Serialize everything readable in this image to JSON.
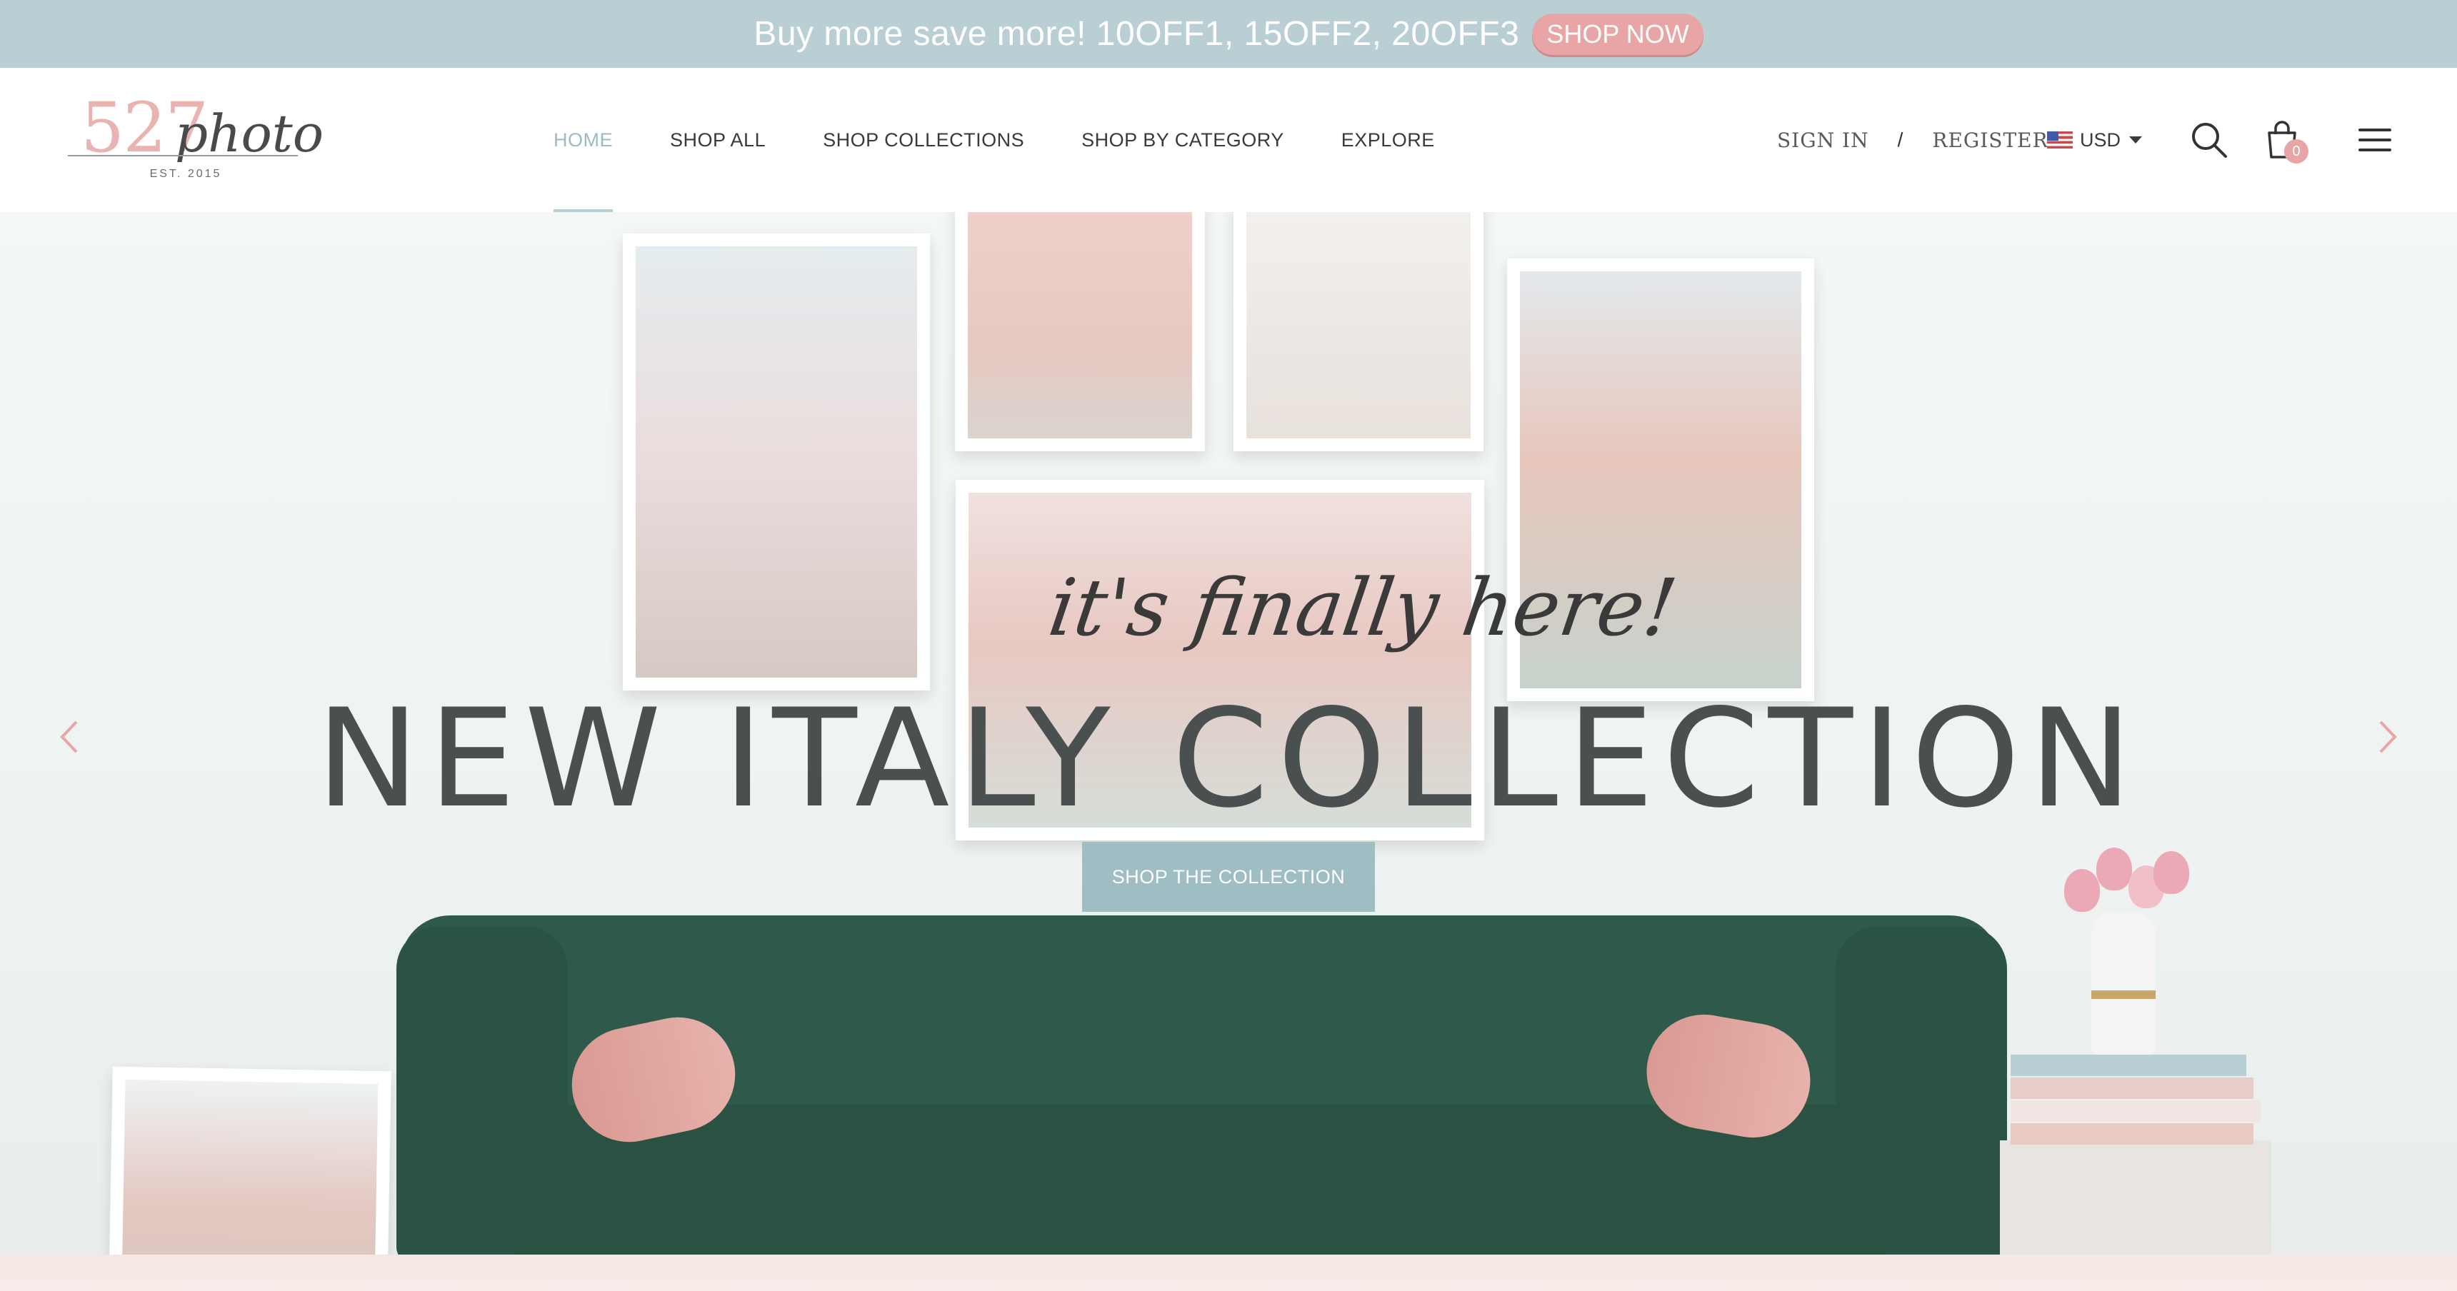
{
  "promo": {
    "text": "Buy more save more! 10OFF1, 15OFF2, 20OFF3",
    "button": "SHOP NOW"
  },
  "logo": {
    "number": "527",
    "script": "photo",
    "est": "EST. 2015"
  },
  "nav": {
    "items": [
      {
        "label": "HOME",
        "active": true
      },
      {
        "label": "SHOP ALL"
      },
      {
        "label": "SHOP COLLECTIONS"
      },
      {
        "label": "SHOP BY CATEGORY"
      },
      {
        "label": "EXPLORE"
      }
    ]
  },
  "account": {
    "sign_in": "SIGN IN",
    "separator": "/",
    "register": "REGISTER"
  },
  "currency": {
    "selected": "USD",
    "flag_icon": "us-flag-icon"
  },
  "cart": {
    "count": "0"
  },
  "icons": {
    "search": "search-icon",
    "cart": "shopping-bag-icon",
    "menu": "hamburger-menu-icon",
    "prev": "chevron-left-icon",
    "next": "chevron-right-icon"
  },
  "hero": {
    "tagline": "it's finally here!",
    "headline": "NEW ITALY COLLECTION",
    "cta": "SHOP THE COLLECTION"
  },
  "colors": {
    "promo_bg": "#b9cfd3",
    "accent_pink": "#e8a5a6",
    "cta_bg": "#9fbec3",
    "active_nav": "#9dbcc2",
    "sofa": "#2f5a4b"
  }
}
